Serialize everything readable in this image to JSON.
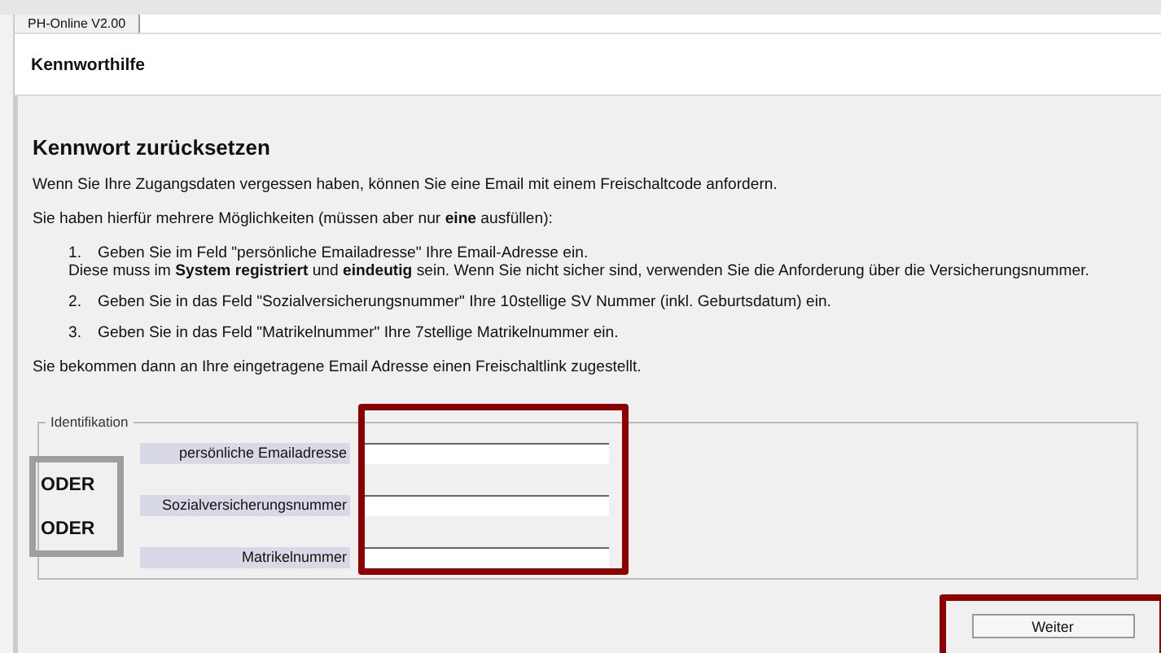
{
  "tab": {
    "label": "PH-Online V2.00"
  },
  "header": {
    "title": "Kennworthilfe"
  },
  "content": {
    "heading": "Kennwort zurücksetzen",
    "intro": [
      "Wenn Sie Ihre Zugangsdaten vergessen haben, können Sie eine Email mit einem Freischaltcode anfordern.",
      "Sie haben hierfür mehrere Möglichkeiten (müssen aber nur **eine** ausfüllen):"
    ],
    "steps": [
      {
        "number": "1.",
        "text": "Geben Sie im Feld \"persönliche Emailadresse\" Ihre Email-Adresse ein.",
        "note": "Diese muss im **System registriert** und **eindeutig** sein. Wenn Sie nicht sicher sind, verwenden Sie die Anforderung über die Versicherungsnummer."
      },
      {
        "number": "2.",
        "text": "Geben Sie in das Feld \"Sozialversicherungsnummer\" Ihre 10stellige SV Nummer (inkl. Geburtsdatum) ein."
      },
      {
        "number": "3.",
        "text": "Geben Sie in das Feld \"Matrikelnummer\" Ihre 7stellige Matrikelnummer ein."
      }
    ],
    "outro": "Sie bekommen dann an Ihre eingetragene Email Adresse einen Freischaltlink zugestellt.",
    "fieldset": {
      "legend": "Identifikation",
      "fields": [
        {
          "label": "persönliche Emailadresse"
        },
        {
          "label": "Sozialversicherungsnummer"
        },
        {
          "label": "Matrikelnummer"
        }
      ]
    },
    "annotation": {
      "or_labels": [
        "ODER",
        "ODER"
      ]
    },
    "button": "Weiter"
  }
}
